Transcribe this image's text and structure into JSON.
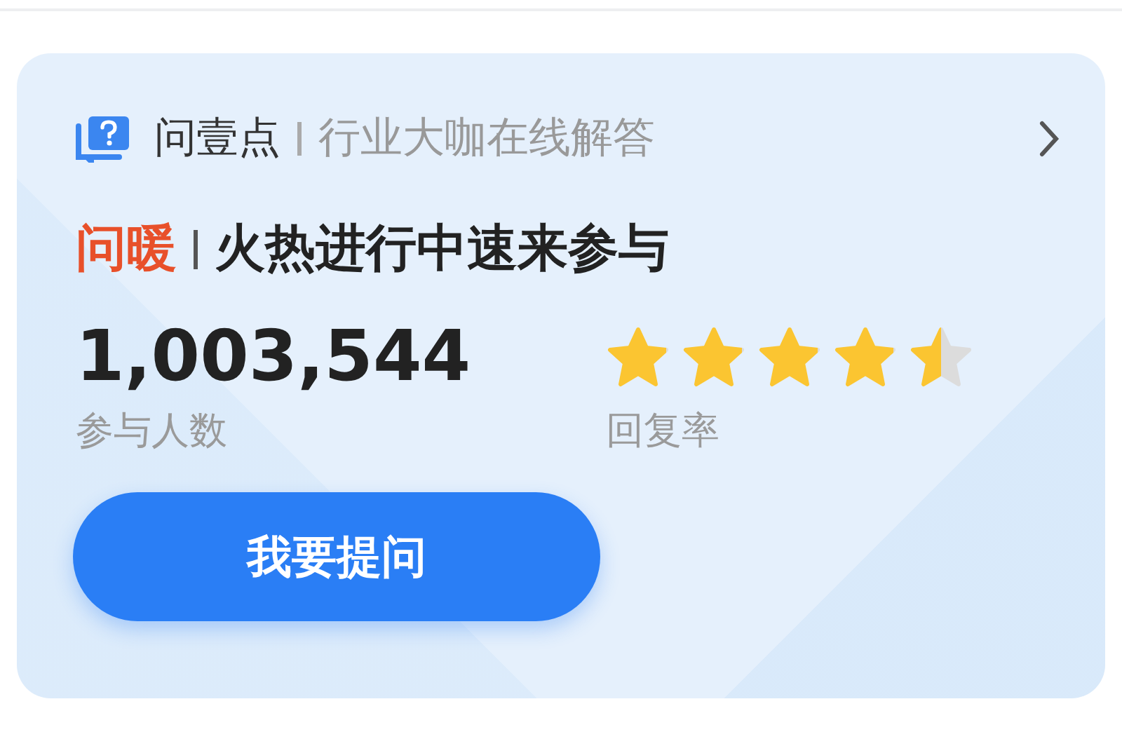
{
  "header": {
    "brand": "问壹点",
    "subtitle": "行业大咖在线解答"
  },
  "headline": {
    "tag": "问暖",
    "text": "火热进行中速来参与"
  },
  "stats": [
    {
      "kind": "number",
      "value": "1,003,544",
      "label": "参与人数"
    },
    {
      "kind": "rating",
      "stars": 4.5,
      "label": "回复率"
    }
  ],
  "button": {
    "label": "我要提问"
  }
}
